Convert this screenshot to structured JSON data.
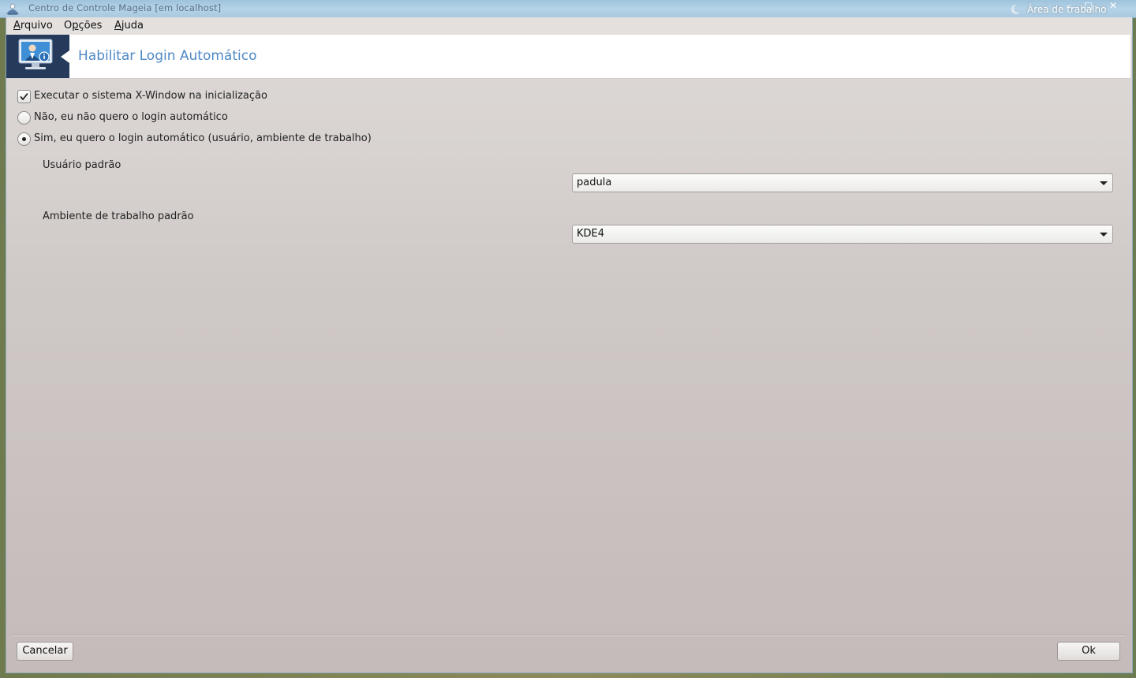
{
  "titlebar": {
    "title": "Centro de Controle Mageia  [em localhost]",
    "workspace": "Área de trabalho",
    "icon": "mageia-star-icon"
  },
  "menu": {
    "items": [
      {
        "label": "Arquivo",
        "mnemonic": "A",
        "rest": "rquivo"
      },
      {
        "label": "Opções",
        "mnemonic": "p",
        "pre": "O",
        "rest": "ções"
      },
      {
        "label": "Ajuda",
        "mnemonic": "A",
        "rest": "juda"
      }
    ]
  },
  "header": {
    "title": "Habilitar Login Automático",
    "icon": "user-monitor-icon",
    "colors": {
      "title": "#4f89c5",
      "icon_bg": "#263a5c"
    }
  },
  "options": {
    "start_x": {
      "label": "Executar o sistema X-Window na inicialização",
      "checked": true
    },
    "no_autologin": {
      "label": "Não, eu não quero o login automático",
      "selected": false
    },
    "yes_autologin": {
      "label": "Sim, eu quero o login automático (usuário, ambiente de trabalho)",
      "selected": true
    }
  },
  "fields": {
    "default_user": {
      "label": "Usuário padrão",
      "value": "padula"
    },
    "default_desktop": {
      "label": "Ambiente de trabalho padrão",
      "value": "KDE4"
    }
  },
  "buttons": {
    "cancel": "Cancelar",
    "ok": "Ok"
  }
}
